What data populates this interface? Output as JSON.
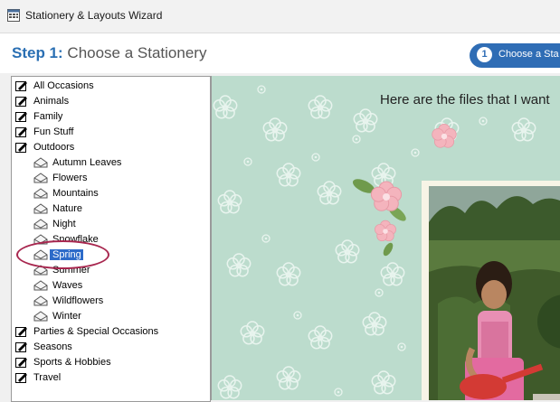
{
  "window": {
    "title": "Stationery & Layouts Wizard"
  },
  "header": {
    "step_number": "Step 1:",
    "step_title": " Choose a Stationery",
    "pill_number": "1",
    "pill_label": "Choose a Sta"
  },
  "tree": {
    "categories": [
      {
        "label": "All Occasions",
        "icon": "stationery-icon"
      },
      {
        "label": "Animals",
        "icon": "stationery-icon"
      },
      {
        "label": "Family",
        "icon": "stationery-icon"
      },
      {
        "label": "Fun Stuff",
        "icon": "stationery-icon"
      },
      {
        "label": "Outdoors",
        "icon": "stationery-icon"
      }
    ],
    "outdoors_children": [
      {
        "label": "Autumn Leaves",
        "icon": "envelope-icon"
      },
      {
        "label": "Flowers",
        "icon": "envelope-icon"
      },
      {
        "label": "Mountains",
        "icon": "envelope-icon"
      },
      {
        "label": "Nature",
        "icon": "envelope-icon"
      },
      {
        "label": "Night",
        "icon": "envelope-icon"
      },
      {
        "label": "Snowflake",
        "icon": "envelope-icon"
      },
      {
        "label": "Spring",
        "icon": "envelope-icon",
        "selected": true
      },
      {
        "label": "Summer",
        "icon": "envelope-icon"
      },
      {
        "label": "Waves",
        "icon": "envelope-icon"
      },
      {
        "label": "Wildflowers",
        "icon": "envelope-icon"
      },
      {
        "label": "Winter",
        "icon": "envelope-icon"
      }
    ],
    "more_categories": [
      {
        "label": "Parties & Special Occasions",
        "icon": "stationery-icon"
      },
      {
        "label": "Seasons",
        "icon": "stationery-icon"
      },
      {
        "label": "Sports & Hobbies",
        "icon": "stationery-icon"
      },
      {
        "label": "Travel",
        "icon": "stationery-icon"
      }
    ]
  },
  "preview": {
    "heading": "Here are the files that I want"
  },
  "colors": {
    "accent": "#2f6db5",
    "selection": "#2d6bc9",
    "callout": "#a8274f",
    "preview_bg": "#bcdccd"
  }
}
